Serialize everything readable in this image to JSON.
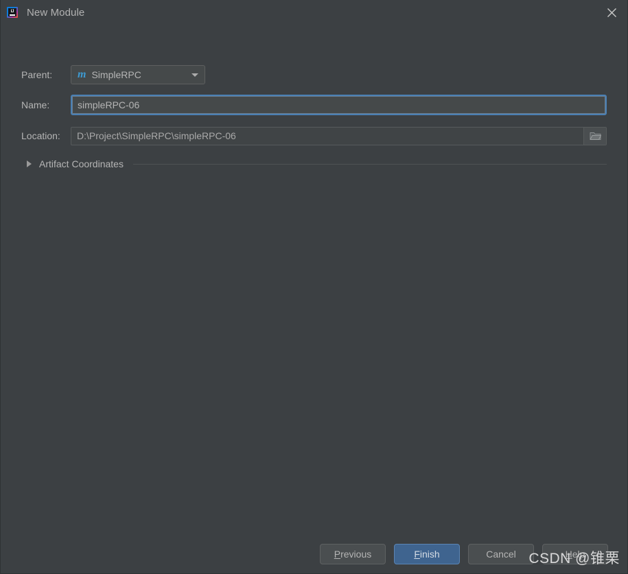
{
  "window": {
    "title": "New Module",
    "app_icon": "intellij-idea-icon",
    "close_icon": "close-icon",
    "background_color": "#3c4043"
  },
  "form": {
    "parent": {
      "label": "Parent:",
      "icon": "maven-module-icon",
      "icon_glyph": "m",
      "icon_color": "#3d9bd3",
      "value": "SimpleRPC",
      "dropdown_icon": "chevron-down-icon"
    },
    "name": {
      "label": "Name:",
      "value": "simpleRPC-06",
      "placeholder": "",
      "focused": true,
      "focus_color": "#4a80b4"
    },
    "location": {
      "label": "Location:",
      "value": "D:\\Project\\SimpleRPC\\simpleRPC-06",
      "browse_icon": "folder-icon"
    }
  },
  "artifact_section": {
    "label": "Artifact Coordinates",
    "expanded": false,
    "toggle_icon": "triangle-right-icon"
  },
  "footer": {
    "buttons": [
      {
        "label": "Previous",
        "mnemonic": "P",
        "rest": "revious",
        "default": false
      },
      {
        "label": "Finish",
        "mnemonic": "F",
        "rest": "inish",
        "default": true
      },
      {
        "label": "Cancel",
        "mnemonic": "",
        "rest": "Cancel",
        "default": false
      },
      {
        "label": "Help",
        "mnemonic": "H",
        "rest": "elp",
        "default": false
      }
    ],
    "default_button_color": "#3f648f"
  },
  "watermark": {
    "text": "CSDN @锥栗"
  }
}
